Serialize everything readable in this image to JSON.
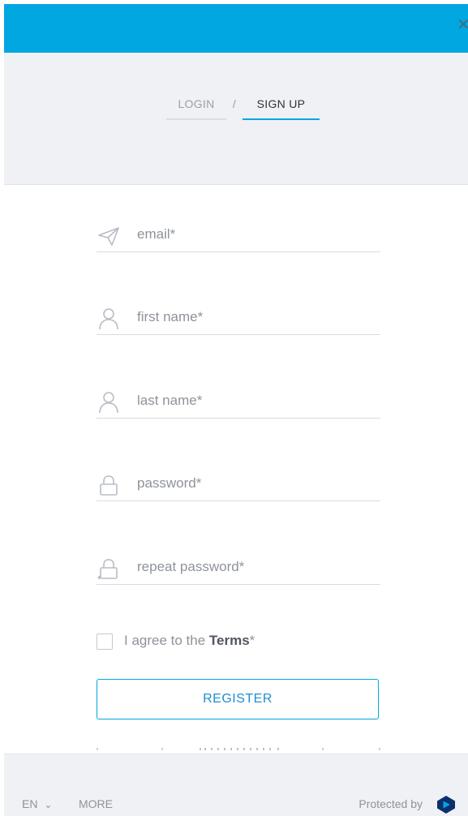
{
  "close_label": "✕",
  "tabs": {
    "login": "LOGIN",
    "separator": "/",
    "signup": "SIGN UP"
  },
  "fields": {
    "email": {
      "placeholder": "email*",
      "value": ""
    },
    "first_name": {
      "placeholder": "first name*",
      "value": ""
    },
    "last_name": {
      "placeholder": "last name*",
      "value": ""
    },
    "password": {
      "placeholder": "password*",
      "value": ""
    },
    "repeat_password": {
      "placeholder": "repeat password*",
      "value": ""
    }
  },
  "agree": {
    "prefix": "I agree to the ",
    "terms": "Terms",
    "suffix": "*"
  },
  "register_label": "REGISTER",
  "footer": {
    "language": "EN",
    "language_caret": "⌄",
    "more": "MORE",
    "protected_by": "Protected by"
  },
  "colors": {
    "accent": "#00a7e1",
    "header_bg": "#eff1f4",
    "text_muted": "#8e939b"
  },
  "icons": [
    "close-icon",
    "paper-plane-icon",
    "user-icon",
    "lock-icon",
    "lock-reset-icon",
    "chevron-down-icon",
    "brand-logo-icon"
  ]
}
